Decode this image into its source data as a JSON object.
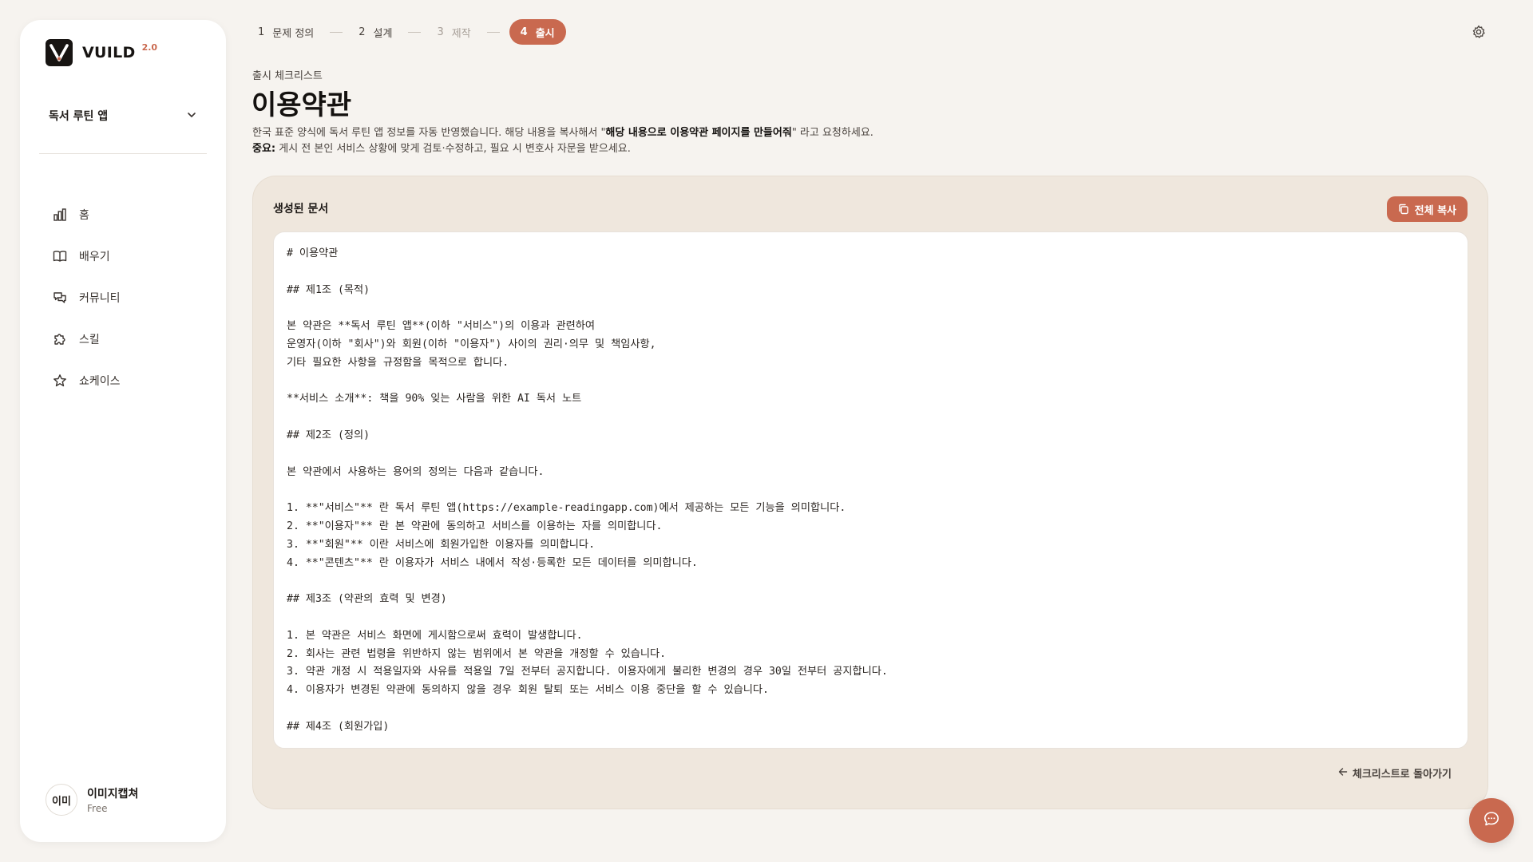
{
  "brand": {
    "name": "VUILD",
    "version": "2.0"
  },
  "project": {
    "selected": "독서 루틴 앱"
  },
  "nav": [
    {
      "label": "홈",
      "icon": "bar-chart-icon"
    },
    {
      "label": "배우기",
      "icon": "book-icon"
    },
    {
      "label": "커뮤니티",
      "icon": "chat-bubbles-icon"
    },
    {
      "label": "스킬",
      "icon": "puzzle-icon"
    },
    {
      "label": "쇼케이스",
      "icon": "star-icon"
    }
  ],
  "user": {
    "avatar_text": "이미",
    "name": "이미지캡쳐",
    "plan": "Free"
  },
  "steps": [
    {
      "num": "1",
      "label": "문제 정의"
    },
    {
      "num": "2",
      "label": "설계"
    },
    {
      "num": "3",
      "label": "제작"
    },
    {
      "num": "4",
      "label": "출시"
    }
  ],
  "header": {
    "eyebrow": "출시 체크리스트",
    "title": "이용약관",
    "desc_line1_pre": "한국 표준 양식에 독서 루틴 앱 정보를 자동 반영했습니다. 해당 내용을 복사해서 \"",
    "desc_line1_bold": "해당 내용으로 이용약관 페이지를 만들어줘",
    "desc_line1_post": "\" 라고 요청하세요.",
    "desc_line2_bold": "중요:",
    "desc_line2_rest": " 게시 전 본인 서비스 상황에 맞게 검토·수정하고, 필요 시 변호사 자문을 받으세요."
  },
  "panel": {
    "title": "생성된 문서",
    "copy_label": "전체 복사",
    "back_label": "체크리스트로 돌아가기",
    "document": "# 이용약관\n\n## 제1조 (목적)\n\n본 약관은 **독서 루틴 앱**(이하 \"서비스\")의 이용과 관련하여\n운영자(이하 \"회사\")와 회원(이하 \"이용자\") 사이의 권리·의무 및 책임사항,\n기타 필요한 사항을 규정함을 목적으로 합니다.\n\n**서비스 소개**: 책을 90% 잊는 사람을 위한 AI 독서 노트\n\n## 제2조 (정의)\n\n본 약관에서 사용하는 용어의 정의는 다음과 같습니다.\n\n1. **\"서비스\"** 란 독서 루틴 앱(https://example-readingapp.com)에서 제공하는 모든 기능을 의미합니다.\n2. **\"이용자\"** 란 본 약관에 동의하고 서비스를 이용하는 자를 의미합니다.\n3. **\"회원\"** 이란 서비스에 회원가입한 이용자를 의미합니다.\n4. **\"콘텐츠\"** 란 이용자가 서비스 내에서 작성·등록한 모든 데이터를 의미합니다.\n\n## 제3조 (약관의 효력 및 변경)\n\n1. 본 약관은 서비스 화면에 게시함으로써 효력이 발생합니다.\n2. 회사는 관련 법령을 위반하지 않는 범위에서 본 약관을 개정할 수 있습니다.\n3. 약관 개정 시 적용일자와 사유를 적용일 7일 전부터 공지합니다. 이용자에게 불리한 변경의 경우 30일 전부터 공지합니다.\n4. 이용자가 변경된 약관에 동의하지 않을 경우 회원 탈퇴 또는 서비스 이용 중단을 할 수 있습니다.\n\n## 제4조 (회원가입)"
  },
  "colors": {
    "accent": "#c9694f",
    "panel_bg": "#efe7dd",
    "page_bg": "#f6f3ef"
  }
}
